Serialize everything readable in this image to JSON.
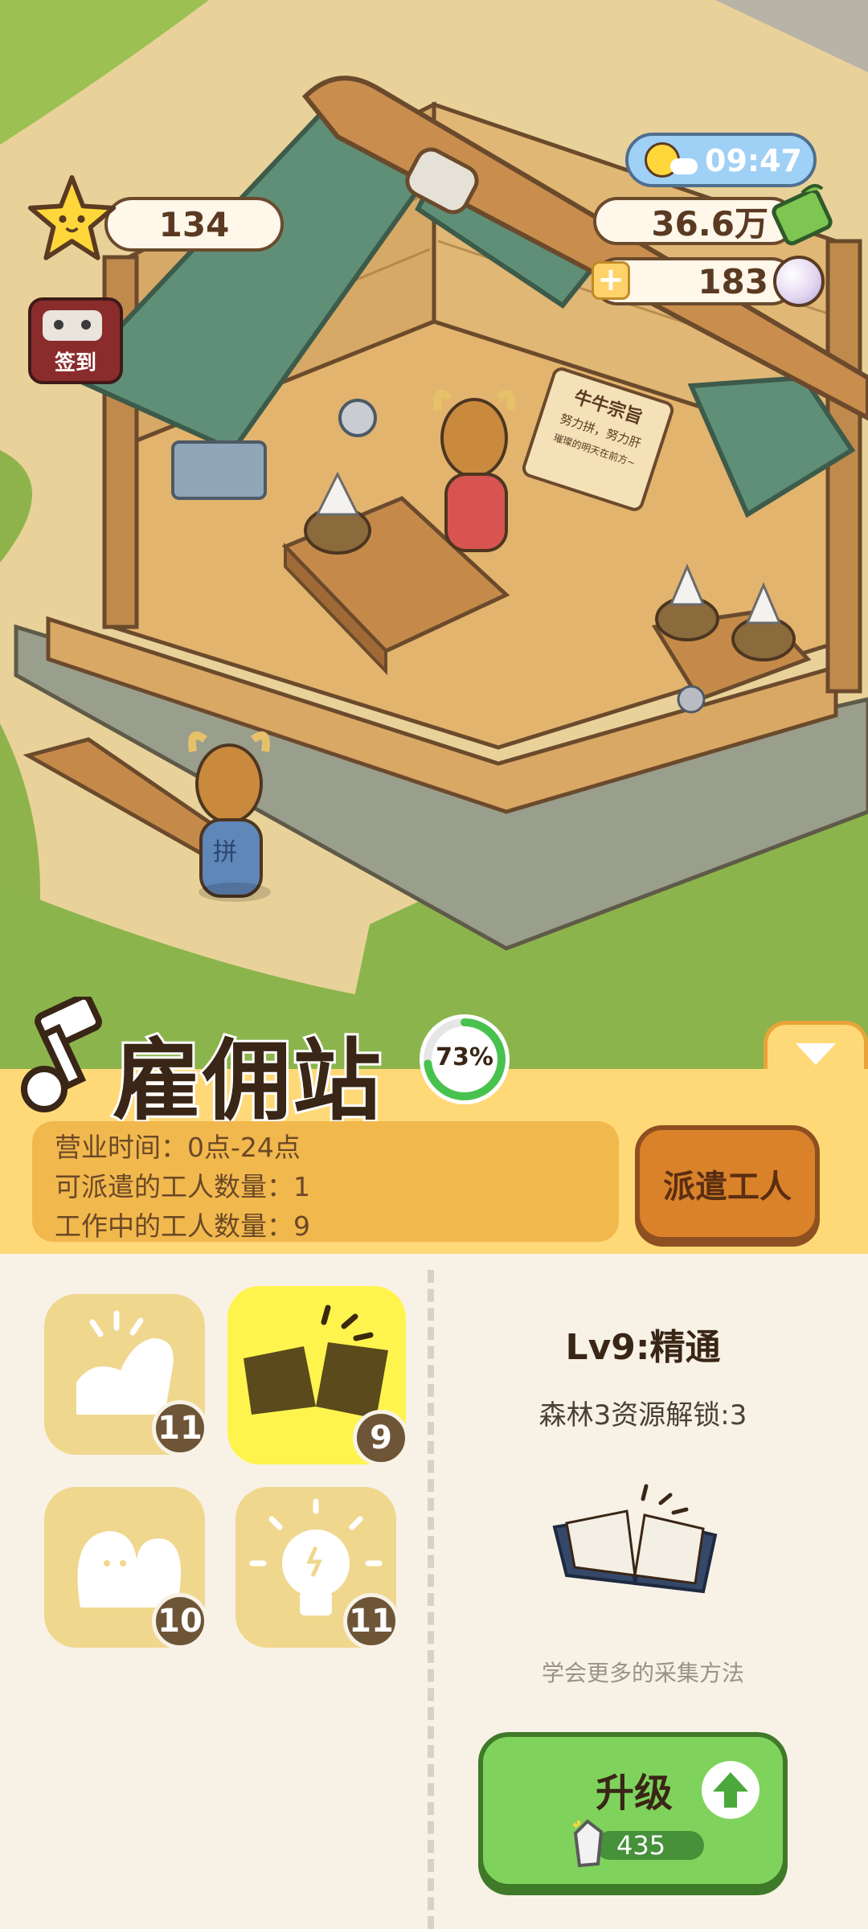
{
  "hud": {
    "stars": "134",
    "time": "09:47",
    "money": "36.6万",
    "pearls": "183",
    "checkin_label": "签到"
  },
  "scene": {
    "sign_title": "牛牛宗旨",
    "sign_line1": "努力拼，努力肝",
    "sign_line2": "璀璨的明天在前方~",
    "worker_shirt_text": "拼"
  },
  "station": {
    "title": "雇佣站",
    "progress_label": "73%",
    "progress": 0.73,
    "info_lines": [
      "营业时间：0点-24点",
      "可派遣的工人数量：1",
      "工作中的工人数量：9"
    ],
    "dispatch_label": "派遣工人"
  },
  "skills": [
    {
      "icon": "muscle-icon",
      "level": "11"
    },
    {
      "icon": "book-icon",
      "level": "9"
    },
    {
      "icon": "people-icon",
      "level": "10"
    },
    {
      "icon": "lightbulb-icon",
      "level": "11"
    }
  ],
  "detail": {
    "level_title": "Lv9:精通",
    "unlock_text": "森林3资源解锁:3",
    "description": "学会更多的采集方法",
    "upgrade_label": "升级",
    "cost": "435"
  },
  "colors": {
    "panel": "#ffd978",
    "info_box": "#f1b84e",
    "dispatch": "#d9822a",
    "upgrade": "#7fd35c",
    "active_skill": "#fff44e",
    "skill": "#f0d78e"
  }
}
